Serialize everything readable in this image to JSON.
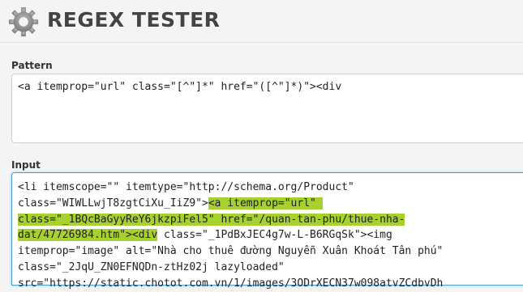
{
  "app": {
    "title": "REGEX TESTER",
    "logo_icon": "gear-icon"
  },
  "pattern": {
    "label": "Pattern",
    "value": "<a itemprop=\"url\" class=\"[^\"]*\" href=\"([^\"]*)\"><div"
  },
  "input": {
    "label": "Input",
    "highlight_color": "#a6d12e",
    "lines": [
      {
        "segments": [
          {
            "text": "<li itemscope=\"\" itemtype=\"http://schema.org/Product\"",
            "match": false
          }
        ]
      },
      {
        "segments": [
          {
            "text": "class=\"WIWLLwjT8zgtCiXu_IiZ9\">",
            "match": false
          },
          {
            "text": "<a itemprop=\"url\" ",
            "match": true
          }
        ]
      },
      {
        "segments": [
          {
            "text": "class=\"_1BQcBaGyyReY6jkzpiFel5\" href=\"/quan-tan-phu/thue-nha-",
            "match": true
          }
        ]
      },
      {
        "segments": [
          {
            "text": "dat/47726984.htm\"><div",
            "match": true
          },
          {
            "text": " class=\"_1PdBxJEC4g7w-L-B6RGqSk\"><img",
            "match": false
          }
        ]
      },
      {
        "segments": [
          {
            "text": "itemprop=\"image\" alt=\"Nhà cho thuê đường Nguyễn Xuân Khoát Tân phú\"",
            "match": false
          }
        ]
      },
      {
        "segments": [
          {
            "text": "class=\"_2JqU_ZN0EFNQDn-ztHz02j lazyloaded\"",
            "match": false
          }
        ]
      },
      {
        "segments": [
          {
            "text": "src=\"https://static.chotot.com.vn/1/images/3ODrXECN37w098atvZCdbvDh",
            "match": false
          }
        ]
      }
    ]
  }
}
